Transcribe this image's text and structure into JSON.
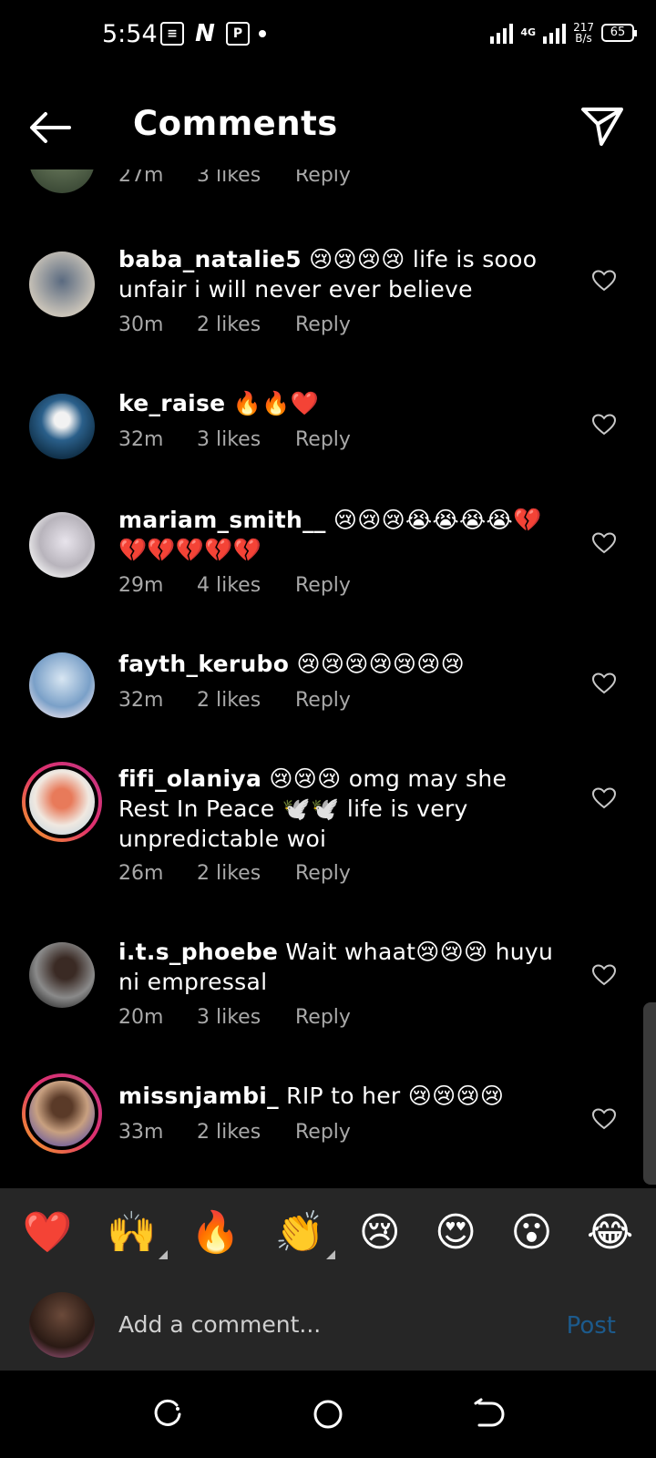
{
  "status_bar": {
    "time": "5:54",
    "network_type": "4G",
    "speed_value": "217",
    "speed_unit": "B/s",
    "battery": "65"
  },
  "header": {
    "title": "Comments"
  },
  "partial_comment": {
    "time": "27m",
    "likes": "3 likes",
    "reply": "Reply"
  },
  "comments": [
    {
      "user": "baba_natalie5",
      "text": " 😢😢😢😢 life is sooo unfair i will never ever believe",
      "time": "30m",
      "likes": "2 likes",
      "reply": "Reply"
    },
    {
      "user": "ke_raise",
      "text": " 🔥🔥❤️",
      "time": "32m",
      "likes": "3 likes",
      "reply": "Reply"
    },
    {
      "user": "mariam_smith__",
      "text": " 😢😢😢😭😭😭😭💔💔💔💔💔💔",
      "time": "29m",
      "likes": "4 likes",
      "reply": "Reply"
    },
    {
      "user": "fayth_kerubo",
      "text": " 😢😢😢😢😢😢😢",
      "time": "32m",
      "likes": "2 likes",
      "reply": "Reply"
    },
    {
      "user": "fifi_olaniya",
      "text": " 😢😢😢 omg may she Rest In Peace 🕊️🕊️ life is very unpredictable woi",
      "time": "26m",
      "likes": "2 likes",
      "reply": "Reply"
    },
    {
      "user": "i.t.s_phoebe",
      "text": " Wait whaat😢😢😢 huyu ni empressal",
      "time": "20m",
      "likes": "3 likes",
      "reply": "Reply"
    },
    {
      "user": "missnjambi_",
      "text": " RIP to her 😢😢😢😢",
      "time": "33m",
      "likes": "2 likes",
      "reply": "Reply"
    }
  ],
  "emoji_bar": [
    "❤️",
    "🙌",
    "🔥",
    "👏",
    "😢",
    "😍",
    "😮",
    "😂"
  ],
  "input": {
    "placeholder": "Add a comment...",
    "post_label": "Post"
  },
  "colors": {
    "background": "#000000",
    "panel": "#262626",
    "meta_text": "#a8a8a8",
    "post_disabled": "#1c5a8c"
  }
}
